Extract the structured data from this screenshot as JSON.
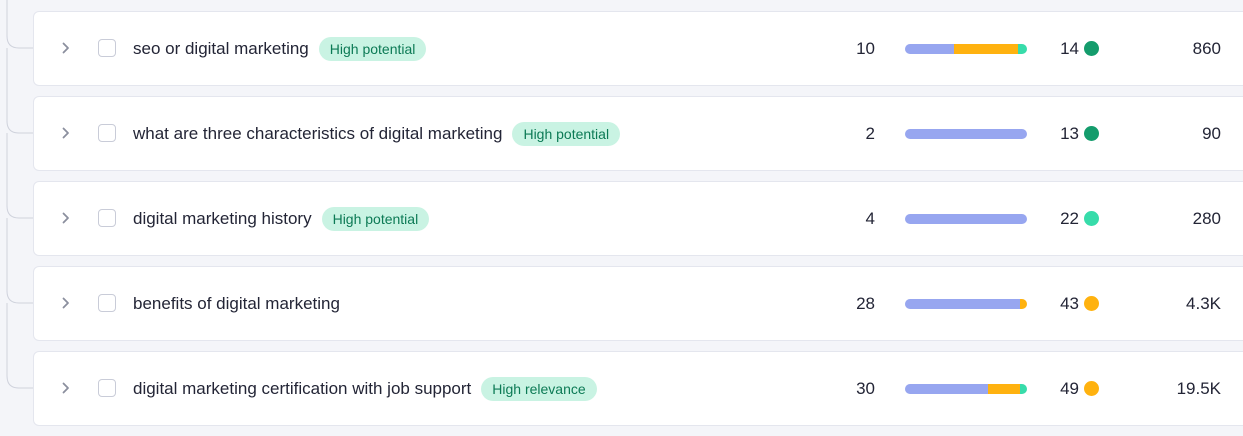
{
  "colors": {
    "bar_blue": "#97a6f0",
    "bar_orange": "#ffb20f",
    "bar_teal": "#37dcaa",
    "dot_dark_green": "#149c6c",
    "dot_teal": "#37dcaa",
    "dot_orange": "#ffb20f",
    "badge_bg": "#c9f3e3",
    "badge_text": "#0c7a55"
  },
  "rows": [
    {
      "keyword": "seo or digital marketing",
      "badge": "High potential",
      "value_a": "10",
      "bar": [
        {
          "color": "bar_blue",
          "fraction": 0.4
        },
        {
          "color": "bar_orange",
          "fraction": 0.53
        },
        {
          "color": "bar_teal",
          "fraction": 0.07
        }
      ],
      "value_b": "14",
      "dot": "dot_dark_green",
      "value_c": "860"
    },
    {
      "keyword": "what are three characteristics of digital marketing",
      "badge": "High potential",
      "value_a": "2",
      "bar": [
        {
          "color": "bar_blue",
          "fraction": 1.0
        }
      ],
      "value_b": "13",
      "dot": "dot_dark_green",
      "value_c": "90"
    },
    {
      "keyword": "digital marketing history",
      "badge": "High potential",
      "value_a": "4",
      "bar": [
        {
          "color": "bar_blue",
          "fraction": 1.0
        }
      ],
      "value_b": "22",
      "dot": "dot_teal",
      "value_c": "280"
    },
    {
      "keyword": "benefits of digital marketing",
      "badge": "",
      "value_a": "28",
      "bar": [
        {
          "color": "bar_blue",
          "fraction": 0.94
        },
        {
          "color": "bar_orange",
          "fraction": 0.06
        }
      ],
      "value_b": "43",
      "dot": "dot_orange",
      "value_c": "4.3K"
    },
    {
      "keyword": "digital marketing certification with job support",
      "badge": "High relevance",
      "value_a": "30",
      "bar": [
        {
          "color": "bar_blue",
          "fraction": 0.68
        },
        {
          "color": "bar_orange",
          "fraction": 0.26
        },
        {
          "color": "bar_teal",
          "fraction": 0.06
        }
      ],
      "value_b": "49",
      "dot": "dot_orange",
      "value_c": "19.5K"
    }
  ]
}
